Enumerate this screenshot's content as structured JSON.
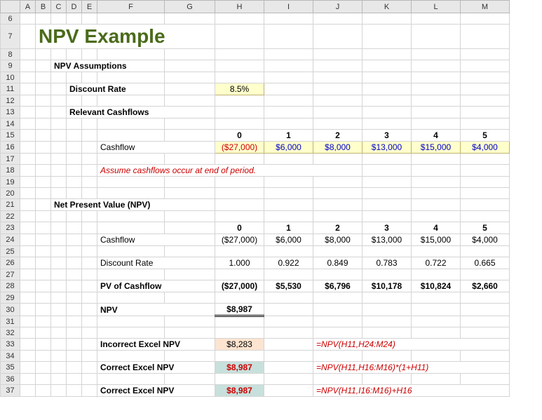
{
  "columns": [
    "A",
    "B",
    "C",
    "D",
    "E",
    "F",
    "G",
    "H",
    "I",
    "J",
    "K",
    "L",
    "M"
  ],
  "row_start": 6,
  "row_end": 37,
  "title": "NPV Example",
  "headers": {
    "assumptions": "NPV Assumptions",
    "discount_rate_label": "Discount Rate",
    "discount_rate_value": "8.5%",
    "relevant_cf": "Relevant Cashflows",
    "cashflow_label": "Cashflow",
    "assume_note": "Assume cashflows occur at end of period.",
    "npv_section": "Net Present Value (NPV)",
    "pv_label": "PV of Cashflow",
    "npv_label": "NPV",
    "incorrect_label": "Incorrect Excel NPV",
    "correct_label": "Correct Excel NPV"
  },
  "periods": [
    "0",
    "1",
    "2",
    "3",
    "4",
    "5"
  ],
  "cashflows_input": [
    "($27,000)",
    "$6,000",
    "$8,000",
    "$13,000",
    "$15,000",
    "$4,000"
  ],
  "cashflows_plain": [
    "($27,000)",
    "$6,000",
    "$8,000",
    "$13,000",
    "$15,000",
    "$4,000"
  ],
  "discount_factors": [
    "1.000",
    "0.922",
    "0.849",
    "0.783",
    "0.722",
    "0.665"
  ],
  "pv_cashflows": [
    "($27,000)",
    "$5,530",
    "$6,796",
    "$10,178",
    "$10,824",
    "$2,660"
  ],
  "npv_value": "$8,987",
  "incorrect_npv": "$8,283",
  "correct_npv1": "$8,987",
  "correct_npv2": "$8,987",
  "formulas": {
    "incorrect": "=NPV(H11,H24:M24)",
    "correct1": "=NPV(H11,H16:M16)*(1+H11)",
    "correct2": "=NPV(H11,I16:M16)+H16"
  }
}
